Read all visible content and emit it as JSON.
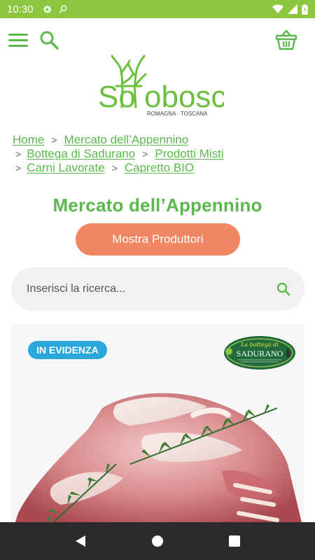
{
  "status_bar": {
    "time": "10:30",
    "icons": [
      "settings-icon",
      "search-icon",
      "wifi-icon",
      "signal-icon",
      "battery-icon"
    ]
  },
  "header": {
    "menu_icon": "hamburger-menu-icon",
    "search_icon": "search-icon",
    "cart_icon": "basket-icon"
  },
  "logo": {
    "name": "Sottobosco",
    "tagline": "ROMAGNA · TOSCANA"
  },
  "breadcrumb": [
    {
      "label": "Home"
    },
    {
      "label": "Mercato dell’Appennino"
    },
    {
      "label": "Bottega di Sadurano"
    },
    {
      "label": "Prodotti Misti"
    },
    {
      "label": "Carni Lavorate"
    },
    {
      "label": "Capretto BIO"
    }
  ],
  "page": {
    "title": "Mercato dell’Appennino",
    "producers_button": "Mostra Produttori"
  },
  "search": {
    "placeholder": "Inserisci la ricerca..."
  },
  "product_card": {
    "badge": "IN EVIDENZA",
    "producer_logo_text": "SADURANO",
    "producer_logo_script": "La bottega di",
    "image": "goat-meat-with-rosemary"
  },
  "colors": {
    "brand_green": "#5bb84c",
    "status_green": "#8cc63f",
    "cta_orange": "#f08762",
    "badge_blue": "#2aa7db",
    "nav_dark": "#2b2b2b"
  },
  "nav_bar": {
    "buttons": [
      "back-icon",
      "home-icon",
      "recents-icon"
    ]
  }
}
